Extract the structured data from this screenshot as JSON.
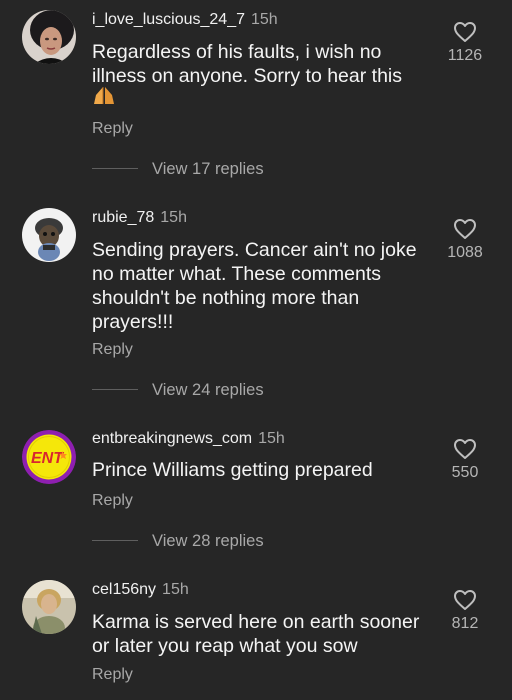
{
  "comments": [
    {
      "username": "i_love_luscious_24_7",
      "time": "15h",
      "text": "Regardless of his faults, i wish no illness on anyone. Sorry to hear this",
      "emoji": "folded-hands",
      "reply_label": "Reply",
      "likes": "1126",
      "view_replies": "View 17 replies"
    },
    {
      "username": "rubie_78",
      "time": "15h",
      "text": "Sending prayers.  Cancer ain't no joke no matter what.  These comments shouldn't be nothing more than prayers!!!",
      "reply_label": "Reply",
      "likes": "1088",
      "view_replies": "View 24 replies"
    },
    {
      "username": "entbreakingnews_com",
      "time": "15h",
      "avatar_text": "ENT",
      "text": "Prince Williams getting prepared",
      "reply_label": "Reply",
      "likes": "550",
      "view_replies": "View 28 replies"
    },
    {
      "username": "cel156ny",
      "time": "15h",
      "text": "Karma is served here on earth sooner or later you reap what you sow",
      "reply_label": "Reply",
      "likes": "812"
    }
  ],
  "icons": {
    "like": "heart-outline-icon"
  },
  "colors": {
    "background": "#262626",
    "text": "#f4f4f4",
    "muted": "#a8a8a8",
    "ent_badge": "#f5e70a",
    "ent_ring": "#8e1fb0",
    "ent_text": "#d8262f"
  }
}
